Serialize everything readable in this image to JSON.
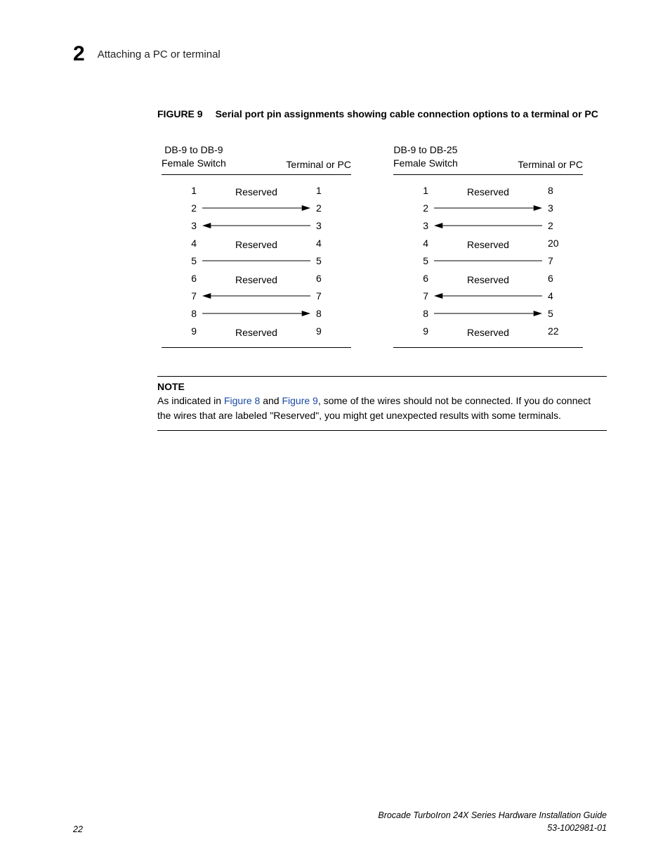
{
  "header": {
    "chapter_number": "2",
    "section_title": "Attaching a PC or terminal"
  },
  "figure": {
    "label": "FIGURE 9",
    "caption": "Serial port pin assignments showing cable connection options to a terminal or PC"
  },
  "diagrams": [
    {
      "left_header_line1": "DB-9 to DB-9",
      "left_header_line2": "Female Switch",
      "right_header": "Terminal or PC",
      "rows": [
        {
          "left": "1",
          "mid": "Reserved",
          "right": "1",
          "type": "text"
        },
        {
          "left": "2",
          "right": "2",
          "type": "arrow-right"
        },
        {
          "left": "3",
          "right": "3",
          "type": "arrow-left"
        },
        {
          "left": "4",
          "mid": "Reserved",
          "right": "4",
          "type": "text"
        },
        {
          "left": "5",
          "right": "5",
          "type": "line"
        },
        {
          "left": "6",
          "mid": "Reserved",
          "right": "6",
          "type": "text"
        },
        {
          "left": "7",
          "right": "7",
          "type": "arrow-left"
        },
        {
          "left": "8",
          "right": "8",
          "type": "arrow-right"
        },
        {
          "left": "9",
          "mid": "Reserved",
          "right": "9",
          "type": "text"
        }
      ]
    },
    {
      "left_header_line1": "DB-9 to DB-25",
      "left_header_line2": "Female Switch",
      "right_header": "Terminal or PC",
      "rows": [
        {
          "left": "1",
          "mid": "Reserved",
          "right": "8",
          "type": "text"
        },
        {
          "left": "2",
          "right": "3",
          "type": "arrow-right"
        },
        {
          "left": "3",
          "right": "2",
          "type": "arrow-left"
        },
        {
          "left": "4",
          "mid": "Reserved",
          "right": "20",
          "type": "text"
        },
        {
          "left": "5",
          "right": "7",
          "type": "line"
        },
        {
          "left": "6",
          "mid": "Reserved",
          "right": "6",
          "type": "text"
        },
        {
          "left": "7",
          "right": "4",
          "type": "arrow-left"
        },
        {
          "left": "8",
          "right": "5",
          "type": "arrow-right"
        },
        {
          "left": "9",
          "mid": "Reserved",
          "right": "22",
          "type": "text"
        }
      ]
    }
  ],
  "note": {
    "label": "NOTE",
    "pre": "As indicated in ",
    "link1": "Figure 8",
    "mid1": " and ",
    "link2": "Figure 9",
    "post": ", some of the wires should not be connected. If you do connect the wires that are labeled \"Reserved\", you might get unexpected results with some terminals."
  },
  "footer": {
    "page_number": "22",
    "doc_title": "Brocade TurboIron 24X Series Hardware Installation Guide",
    "doc_number": "53-1002981-01"
  }
}
